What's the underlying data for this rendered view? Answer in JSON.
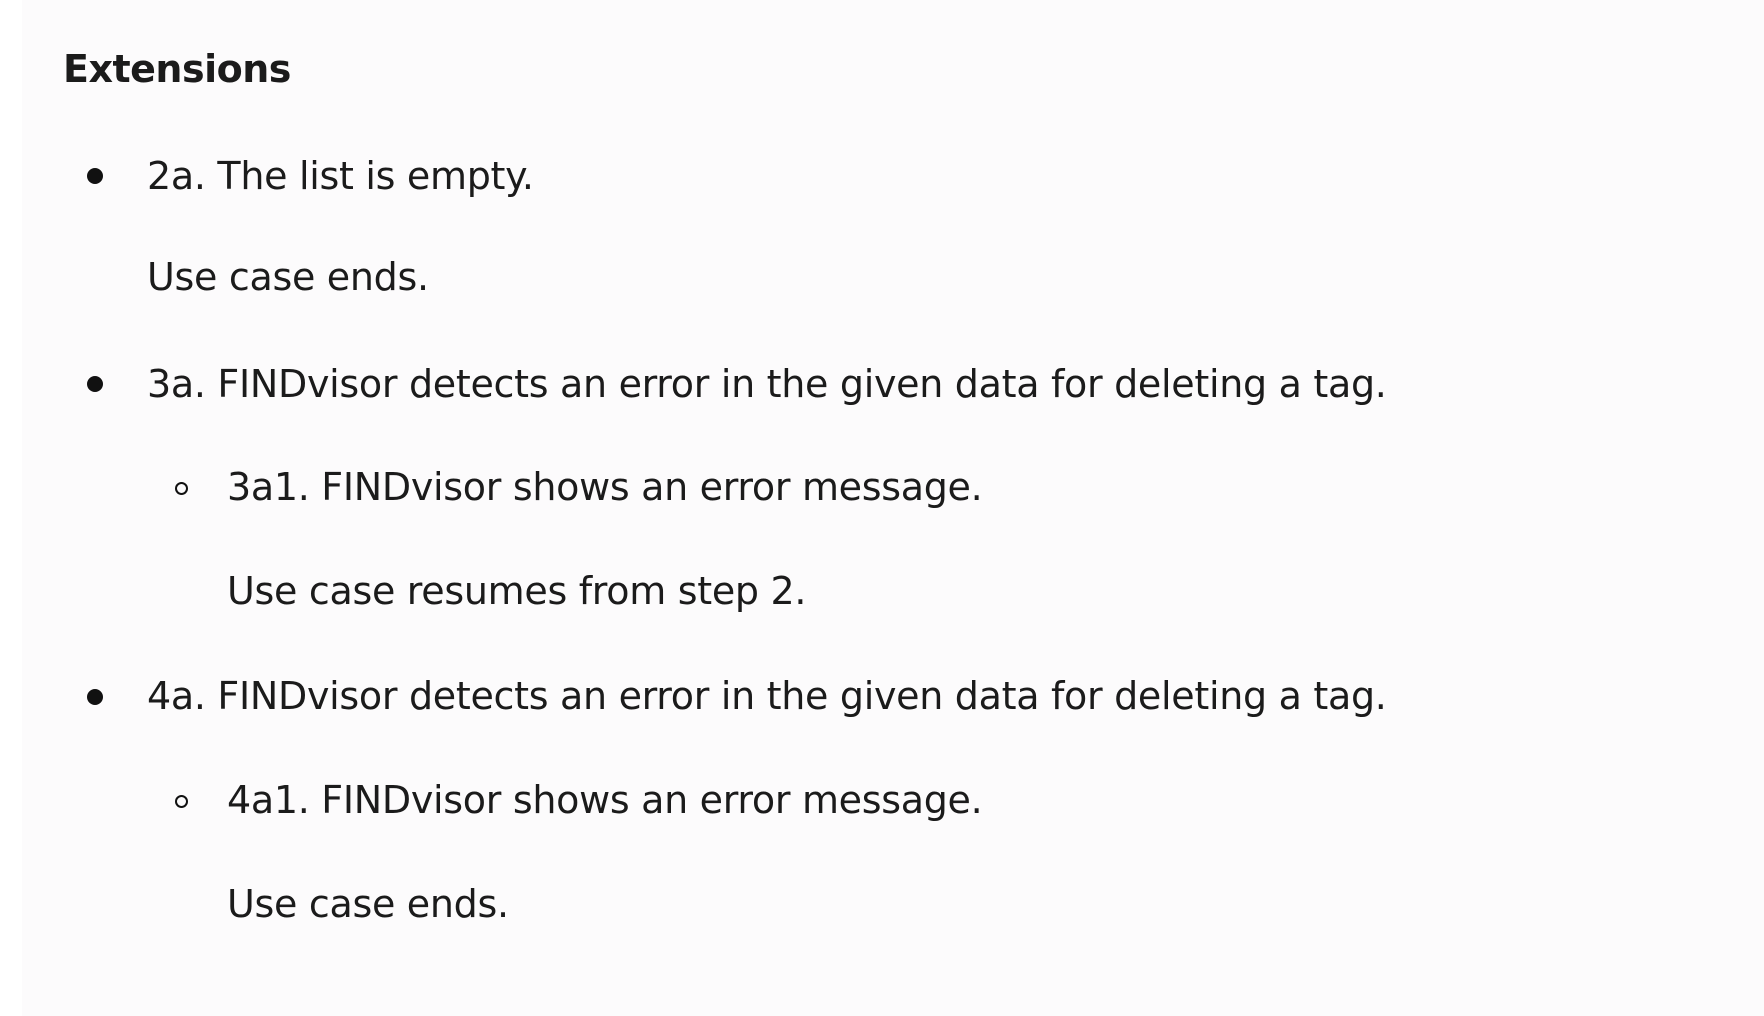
{
  "section": {
    "title": "Extensions"
  },
  "extensions": [
    {
      "text": "2a. The list is empty.",
      "followup": "Use case ends."
    },
    {
      "text": "3a. FINDvisor detects an error in the given data for deleting a tag.",
      "sub": {
        "text": "3a1. FINDvisor shows an error message.",
        "followup": "Use case resumes from step 2."
      }
    },
    {
      "text": "4a. FINDvisor detects an error in the given data for deleting a tag.",
      "sub": {
        "text": "4a1. FINDvisor shows an error message.",
        "followup": "Use case ends."
      }
    }
  ]
}
